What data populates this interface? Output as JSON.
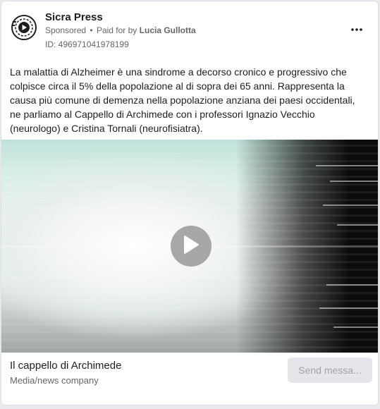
{
  "post": {
    "page_name": "Sicra Press",
    "sponsored_label": "Sponsored",
    "separator": "•",
    "paid_for_prefix": "Paid for by",
    "payer": "Lucia Gullotta",
    "ad_id": "ID: 496971041978199",
    "more_icon": "more-horizontal-icon",
    "body": "La malattia di Alzheimer è una sindrome a decorso cronico e progressivo che colpisce circa il 5% della popolazione al di sopra dei 65 anni. Rappresenta la causa più comune di demenza nella popolazione anziana dei paesi occidentali, ne parliamo al Cappello di Archimede con i professori Ignazio Vecchio (neurologo) e Cristina Tornali (neurofisiatra)."
  },
  "video": {
    "play_icon": "play-icon"
  },
  "footer": {
    "link_title": "Il cappello di Archimede",
    "category": "Media/news company",
    "cta_label": "Send messa..."
  },
  "colors": {
    "card_bg": "#ffffff",
    "text_primary": "#1c1e21",
    "text_secondary": "#65676b",
    "button_bg": "#e4e6eb",
    "button_text": "#a0a3a8"
  }
}
